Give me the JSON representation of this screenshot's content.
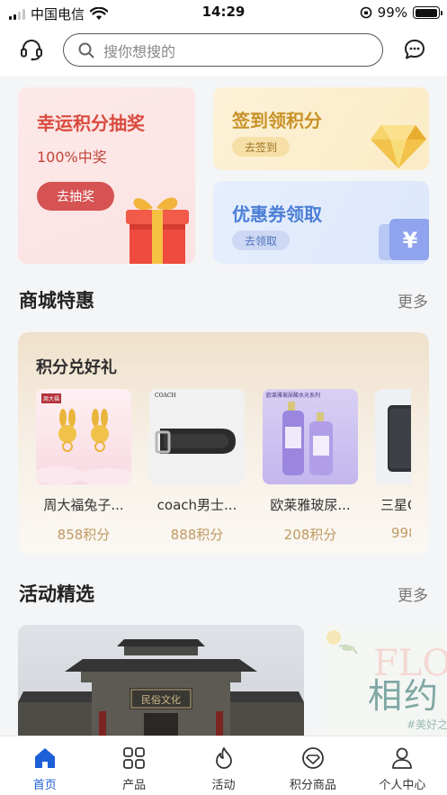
{
  "status_bar": {
    "carrier": "中国电信",
    "time": "14:29",
    "battery": "99%",
    "battery_level": 0.99
  },
  "header": {
    "search_placeholder": "搜你想搜的",
    "left_icon": "headset-icon",
    "right_icon": "chat-bubble-icon"
  },
  "promos": {
    "lottery": {
      "title": "幸运积分抽奖",
      "subtitle": "100%中奖",
      "button": "去抽奖"
    },
    "checkin": {
      "title": "签到领积分",
      "button": "去签到"
    },
    "coupon": {
      "title": "优惠券领取",
      "button": "去领取",
      "ticket_symbol": "¥"
    }
  },
  "mall": {
    "title": "商城特惠",
    "more": "更多",
    "subtitle": "积分兑好礼",
    "products": [
      {
        "name": "周大福兔子...",
        "points": "858积分",
        "brand": "周大福"
      },
      {
        "name": "coach男士...",
        "points": "888积分",
        "brand": "COACH"
      },
      {
        "name": "欧莱雅玻尿...",
        "points": "208积分",
        "brand": "欧莱雅玻尿酸水光系列"
      },
      {
        "name": "三星G",
        "points": "998"
      }
    ]
  },
  "activities": {
    "title": "活动精选",
    "more": "更多",
    "items": [
      {
        "sign_text": "民俗文化"
      },
      {
        "big_text": "相约",
        "bg_text": "FLO",
        "tag": "#美好之"
      }
    ]
  },
  "tabbar": {
    "active": 0,
    "active_color": "#1d5fd6",
    "items": [
      {
        "label": "首页",
        "icon": "home-icon"
      },
      {
        "label": "产品",
        "icon": "grid-icon"
      },
      {
        "label": "活动",
        "icon": "flame-icon"
      },
      {
        "label": "积分商品",
        "icon": "diamond-badge-icon"
      },
      {
        "label": "个人中心",
        "icon": "person-icon"
      }
    ]
  }
}
